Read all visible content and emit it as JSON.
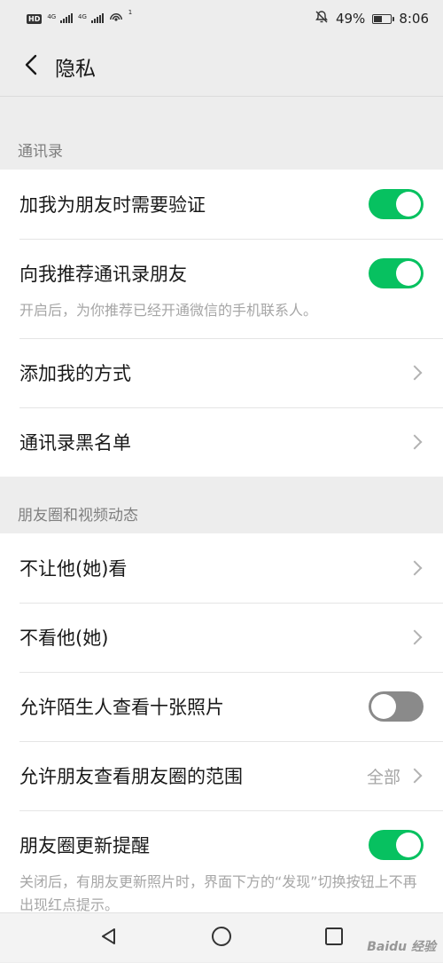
{
  "status_bar": {
    "hd_badge": "HD",
    "network_1": "4G",
    "network_2": "4G",
    "hotspot_count": "1",
    "battery_text": "49%",
    "battery_level": 0.49,
    "time": "8:06"
  },
  "header": {
    "title": "隐私"
  },
  "section_contacts": {
    "title": "通讯录",
    "items": [
      {
        "label": "加我为朋友时需要验证",
        "type": "toggle",
        "on": true
      },
      {
        "label": "向我推荐通讯录朋友",
        "type": "toggle",
        "on": true,
        "description": "开启后，为你推荐已经开通微信的手机联系人。"
      },
      {
        "label": "添加我的方式",
        "type": "link"
      },
      {
        "label": "通讯录黑名单",
        "type": "link"
      }
    ]
  },
  "section_moments": {
    "title": "朋友圈和视频动态",
    "items": [
      {
        "label": "不让他(她)看",
        "type": "link"
      },
      {
        "label": "不看他(她)",
        "type": "link"
      },
      {
        "label": "允许陌生人查看十张照片",
        "type": "toggle",
        "on": false
      },
      {
        "label": "允许朋友查看朋友圈的范围",
        "type": "link",
        "value": "全部"
      },
      {
        "label": "朋友圈更新提醒",
        "type": "toggle",
        "on": true,
        "description": "关闭后，有朋友更新照片时，界面下方的“发现”切换按钮上不再出现红点提示。"
      }
    ]
  },
  "colors": {
    "accent": "#07c160",
    "background": "#ededed",
    "toggle_off": "#8a8a8a"
  },
  "system_nav": {
    "icons": [
      "back-triangle-icon",
      "home-circle-icon",
      "recents-square-icon"
    ]
  },
  "watermark": "Baidu 经验"
}
